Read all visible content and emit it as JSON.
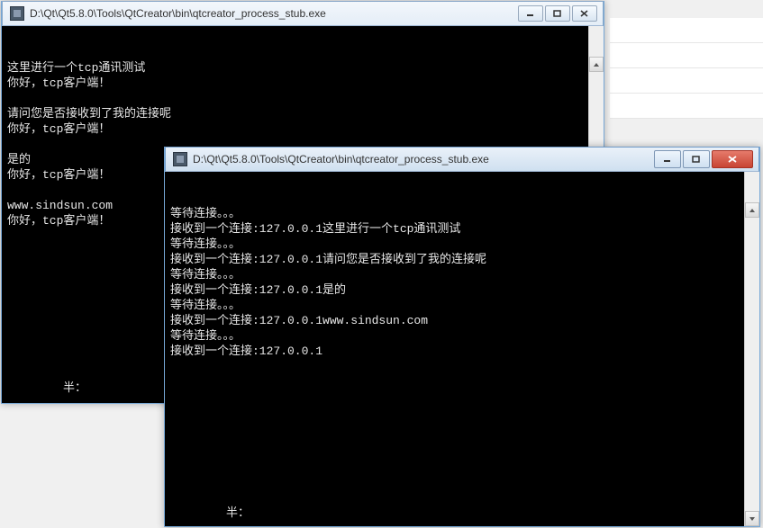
{
  "background_notebook_lines": 4,
  "win1": {
    "title": "D:\\Qt\\Qt5.8.0\\Tools\\QtCreator\\bin\\qtcreator_process_stub.exe",
    "lines": [
      "这里进行一个tcp通讯测试",
      "你好，tcp客户端！",
      "",
      "请问您是否接收到了我的连接呢",
      "你好，tcp客户端！",
      "",
      "是的",
      "你好，tcp客户端！",
      "",
      "www.sindsun.com",
      "你好，tcp客户端！"
    ],
    "prompt": "半："
  },
  "win2": {
    "title": "D:\\Qt\\Qt5.8.0\\Tools\\QtCreator\\bin\\qtcreator_process_stub.exe",
    "lines": [
      "等待连接。。。",
      "接收到一个连接:127.0.0.1这里进行一个tcp通讯测试",
      "等待连接。。。",
      "接收到一个连接:127.0.0.1请问您是否接收到了我的连接呢",
      "等待连接。。。",
      "接收到一个连接:127.0.0.1是的",
      "等待连接。。。",
      "接收到一个连接:127.0.0.1www.sindsun.com",
      "等待连接。。。",
      "接收到一个连接:127.0.0.1"
    ],
    "prompt": "半："
  }
}
